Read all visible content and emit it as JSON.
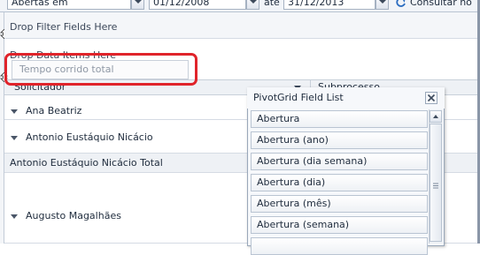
{
  "toolbar": {
    "status_select_value": "Abertas em",
    "date_from": "01/12/2008",
    "date_separator": "até",
    "date_to": "31/12/2013",
    "consult_button_label": "Consultar no"
  },
  "pivot": {
    "filter_area_text": "Drop Filter Fields Here",
    "data_area_text": "Drop Data Items Here",
    "data_field_chip": "Tempo corrido total",
    "row_header_field": "Solicitador",
    "column_header_field": "Subprocesso",
    "rows": [
      {
        "label": "Ana Beatriz"
      },
      {
        "label": "Antonio Eustáquio Nicácio"
      },
      {
        "label": "Antonio Eustáquio Nicácio Total"
      },
      {
        "label": "Augusto Magalhães"
      }
    ]
  },
  "field_list": {
    "title": "PivotGrid Field List",
    "items": [
      "Abertura",
      "Abertura (ano)",
      "Abertura (dia semana)",
      "Abertura (dia)",
      "Abertura (mês)",
      "Abertura (semana)"
    ]
  },
  "colors": {
    "highlight": "#e0242b",
    "header_bg": "#eef1f5",
    "border": "#b9c4d2"
  }
}
